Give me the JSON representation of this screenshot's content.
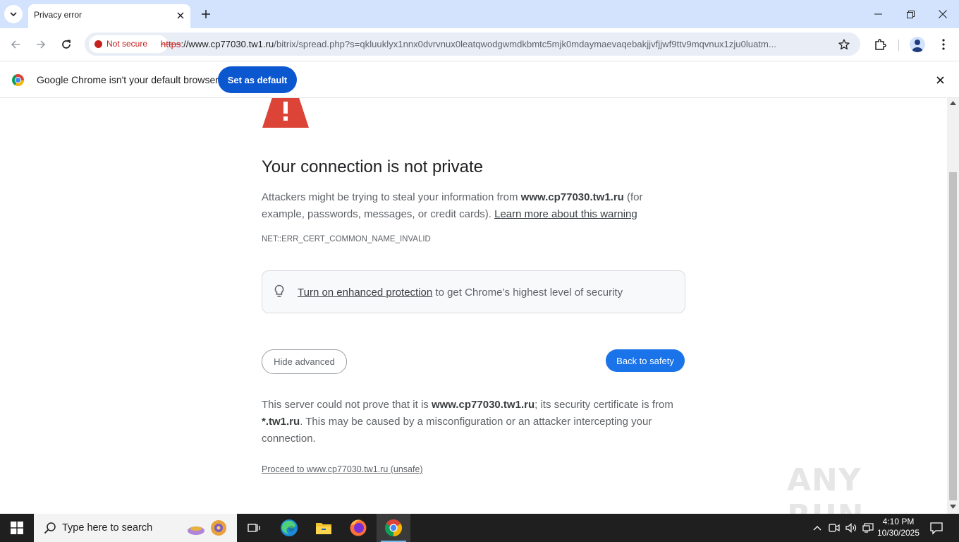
{
  "tab": {
    "title": "Privacy error"
  },
  "toolbar": {
    "security_chip": "Not secure",
    "url_scheme": "https",
    "url_rest": "://www.cp77030.tw1.ru",
    "url_path": "/bitrix/spread.php?s=qkluuklyx1nnx0dvrvnux0leatqwodgwmdkbmtc5mjk0mdaymaevaqebakjjvfjjwf9ttv9mqvnux1zju0luatm..."
  },
  "infobar": {
    "message": "Google Chrome isn't your default browser",
    "button": "Set as default"
  },
  "interstitial": {
    "heading": "Your connection is not private",
    "explain_pre": "Attackers might be trying to steal your information from ",
    "explain_host": "www.cp77030.tw1.ru",
    "explain_post": " (for example, passwords, messages, or credit cards). ",
    "learn_more": "Learn more about this warning",
    "error_code": "NET::ERR_CERT_COMMON_NAME_INVALID",
    "enhanced_link": "Turn on enhanced protection",
    "enhanced_rest": " to get Chrome’s highest level of security",
    "hide_advanced": "Hide advanced",
    "back_to_safety": "Back to safety",
    "details_1": "This server could not prove that it is ",
    "details_host": "www.cp77030.tw1.ru",
    "details_2": "; its security certificate is from ",
    "details_cert": "*.tw1.ru",
    "details_3": ". This may be caused by a misconfiguration or an attacker intercepting your connection.",
    "proceed": "Proceed to www.cp77030.tw1.ru (unsafe)"
  },
  "watermark": "ANY RUN",
  "taskbar": {
    "search_placeholder": "Type here to search",
    "time": "4:10 PM",
    "date": "10/30/2025"
  },
  "icons": [
    "tab-search-icon",
    "close-icon",
    "plus-icon",
    "minimize-icon",
    "restore-icon",
    "back-icon",
    "forward-icon",
    "reload-icon",
    "star-icon",
    "extensions-icon",
    "profile-icon",
    "kebab-menu-icon",
    "warning-triangle-icon",
    "lightbulb-icon",
    "windows-logo-icon",
    "search-icon",
    "task-view-icon",
    "edge-icon",
    "file-explorer-icon",
    "firefox-icon",
    "chrome-icon",
    "chevron-up-icon",
    "network-icon",
    "volume-icon",
    "notification-icon"
  ],
  "colors": {
    "tab_strip": "#d3e3fd",
    "not_secure_red": "#c5221f",
    "primary_blue": "#1a73e8",
    "warning_red": "#db4437",
    "taskbar": "#1f1f1f"
  }
}
